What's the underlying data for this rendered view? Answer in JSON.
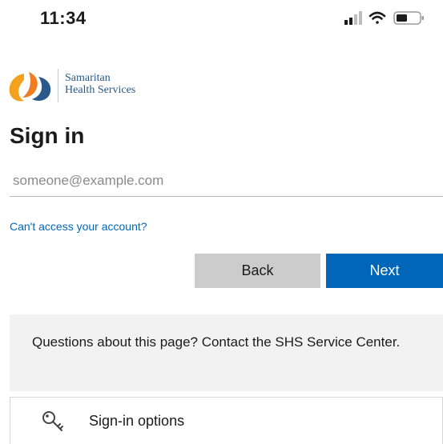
{
  "status_bar": {
    "time": "11:34"
  },
  "brand": {
    "line1": "Samaritan",
    "line2": "Health Services"
  },
  "page": {
    "title": "Sign in"
  },
  "email": {
    "placeholder": "someone@example.com",
    "value": ""
  },
  "links": {
    "cant_access": "Can't access your account?"
  },
  "buttons": {
    "back": "Back",
    "next": "Next"
  },
  "info": {
    "text": "Questions about this page? Contact the SHS Service Center."
  },
  "options": {
    "label": "Sign-in options"
  },
  "colors": {
    "accent": "#0067b8",
    "back_button": "#cccccc",
    "panel": "#f2f2f2"
  },
  "icons": [
    "signal-icon",
    "wifi-icon",
    "battery-icon",
    "samaritan-logo-icon",
    "key-icon"
  ]
}
